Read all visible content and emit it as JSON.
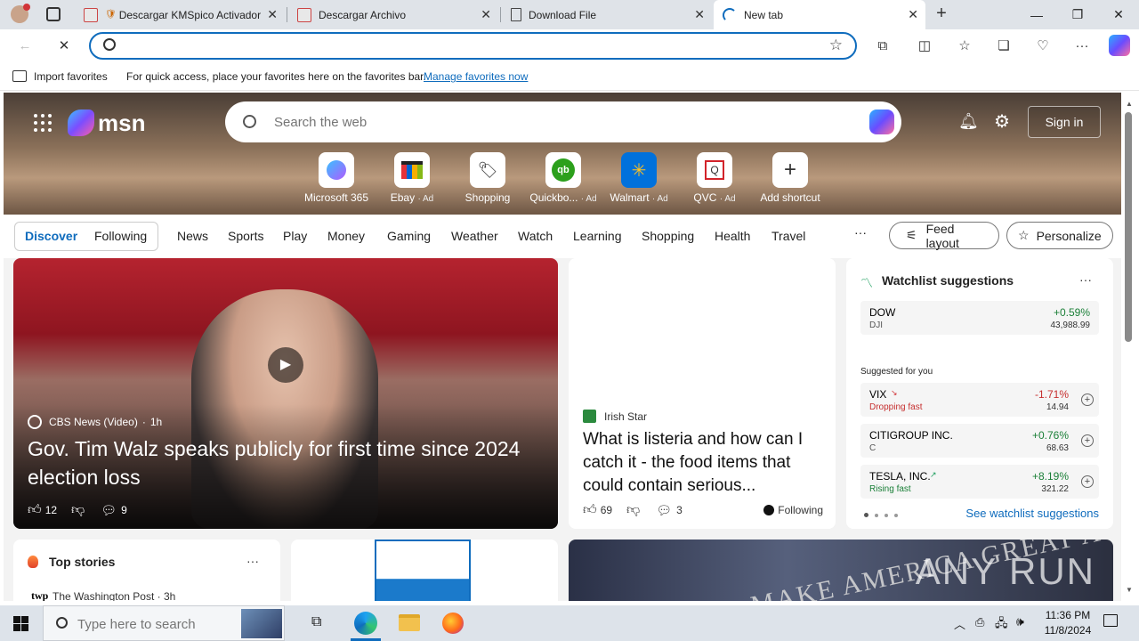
{
  "browser": {
    "tabs": [
      {
        "title": "Descargar KMSpico Activador"
      },
      {
        "title": "Descargar Archivo"
      },
      {
        "title": "Download File"
      },
      {
        "title": "New tab"
      }
    ],
    "address_value": "",
    "favorites_bar": {
      "import_label": "Import favorites",
      "message": "For quick access, place your favorites here on the favorites bar.",
      "manage_link": "Manage favorites now"
    }
  },
  "msn": {
    "logo_text": "msn",
    "search_placeholder": "Search the web",
    "sign_in": "Sign in",
    "shortcuts": [
      {
        "label": "Microsoft 365",
        "ad": ""
      },
      {
        "label": "Ebay",
        "ad": "· Ad"
      },
      {
        "label": "Shopping",
        "ad": ""
      },
      {
        "label": "Quickbo...",
        "ad": "· Ad"
      },
      {
        "label": "Walmart",
        "ad": "· Ad"
      },
      {
        "label": "QVC",
        "ad": "· Ad"
      },
      {
        "label": "Add shortcut",
        "ad": ""
      }
    ],
    "nav": {
      "discover": "Discover",
      "following": "Following",
      "items": [
        "News",
        "Sports",
        "Play",
        "Money",
        "Gaming",
        "Weather",
        "Watch",
        "Learning",
        "Shopping",
        "Health",
        "Travel"
      ],
      "more": "···",
      "feed_layout": "Feed layout",
      "personalize": "Personalize"
    },
    "hero_story": {
      "source": "CBS News (Video)",
      "age": "1h",
      "headline": "Gov. Tim Walz speaks publicly for first time since 2024 election loss",
      "likes": "12",
      "comments": "9"
    },
    "side_story": {
      "source": "Irish Star",
      "headline": "What is listeria and how can I catch it - the food items that could contain serious...",
      "likes": "69",
      "comments": "3",
      "following": "Following"
    },
    "watchlist": {
      "title": "Watchlist suggestions",
      "menu": "···",
      "dow": {
        "name": "DOW",
        "ticker": "DJI",
        "change": "+0.59%",
        "price": "43,988.99"
      },
      "suggested_label": "Suggested for you",
      "items": [
        {
          "name": "VIX",
          "sub": "Dropping fast",
          "change": "-1.71%",
          "price": "14.94"
        },
        {
          "name": "CITIGROUP INC.",
          "sub": "C",
          "change": "+0.76%",
          "price": "68.63"
        },
        {
          "name": "TESLA, INC.",
          "sub": "Rising fast",
          "change": "+8.19%",
          "price": "321.22"
        }
      ],
      "see_more": "See watchlist suggestions"
    },
    "top_stories": {
      "title": "Top stories",
      "menu": "···",
      "first_source": "The Washington Post · 3h"
    },
    "bottom_right_caption": "MAKE AMERICA GREAT AGAIN",
    "watermark": "ANY RUN"
  },
  "taskbar": {
    "search_placeholder": "Type here to search",
    "time": "11:36 PM",
    "date": "11/8/2024"
  }
}
